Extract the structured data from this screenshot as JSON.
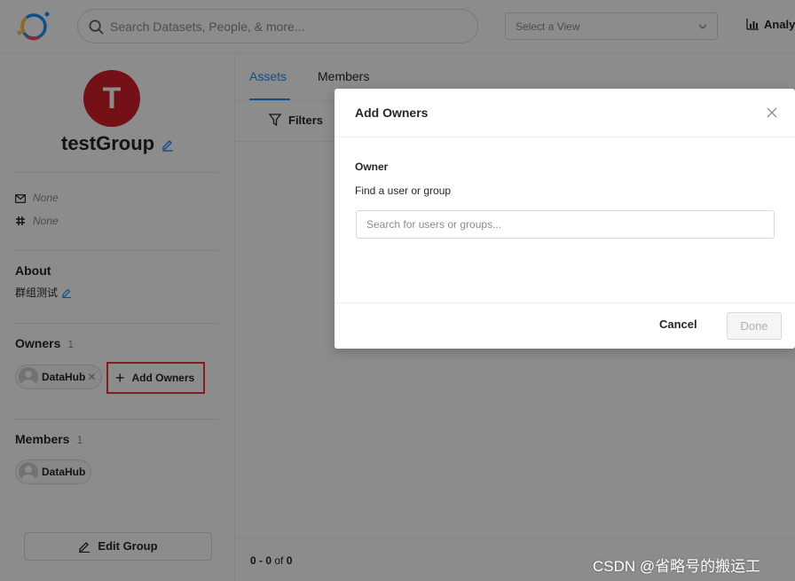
{
  "header": {
    "search_placeholder": "Search Datasets, People, & more...",
    "view_select_placeholder": "Select a View",
    "analytics_label": "Analytics"
  },
  "sidebar": {
    "avatar_letter": "T",
    "group_name": "testGroup",
    "email": "None",
    "slack": "None",
    "about": {
      "title": "About",
      "text": "群组测试"
    },
    "owners": {
      "title": "Owners",
      "count": "1",
      "chips": [
        "DataHub"
      ],
      "add_label": "Add Owners"
    },
    "members": {
      "title": "Members",
      "count": "1",
      "chips": [
        "DataHub"
      ]
    },
    "edit_group_label": "Edit Group"
  },
  "main": {
    "tabs": [
      {
        "label": "Assets",
        "active": true
      },
      {
        "label": "Members",
        "active": false
      }
    ],
    "filters_label": "Filters",
    "pagination": {
      "range": "0 - 0",
      "of": "of",
      "total": "0"
    }
  },
  "modal": {
    "title": "Add Owners",
    "owner_label": "Owner",
    "find_label": "Find a user or group",
    "input_placeholder": "Search for users or groups...",
    "cancel_label": "Cancel",
    "done_label": "Done"
  },
  "watermark": "CSDN @省略号的搬运工",
  "colors": {
    "accent": "#1890ff",
    "avatar": "#d32029",
    "highlight_box": "#e53935"
  }
}
